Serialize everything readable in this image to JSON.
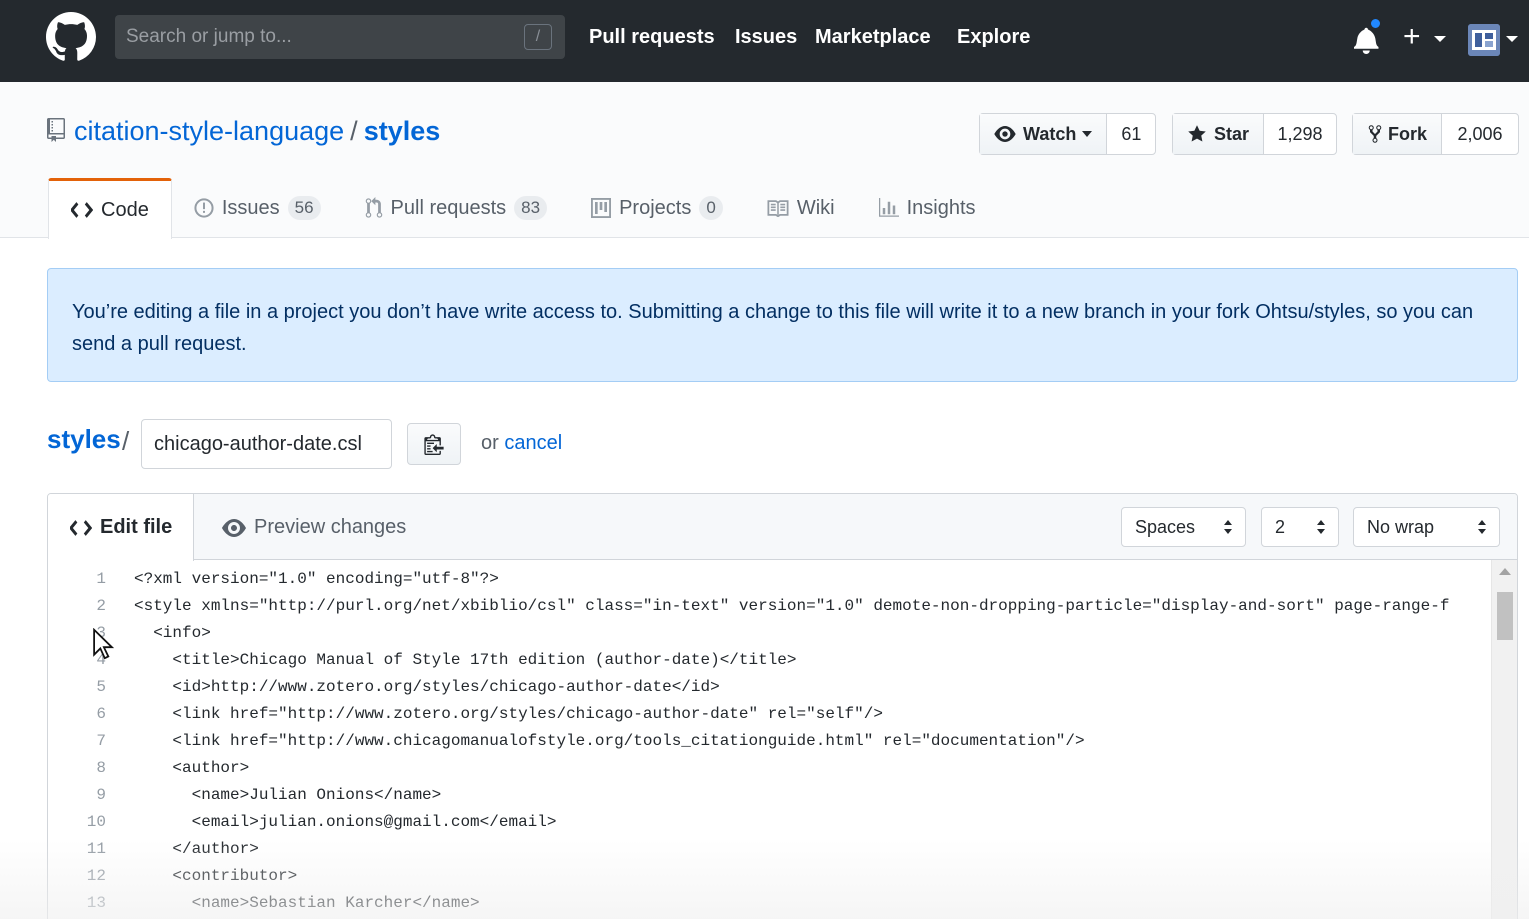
{
  "header": {
    "search_placeholder": "Search or jump to...",
    "search_shortcut": "/",
    "nav": [
      "Pull requests",
      "Issues",
      "Marketplace",
      "Explore"
    ],
    "plus_label": "+"
  },
  "repo": {
    "owner": "citation-style-language",
    "separator": "/",
    "name": "styles",
    "watch_label": "Watch",
    "watch_count": "61",
    "star_label": "Star",
    "star_count": "1,298",
    "fork_label": "Fork",
    "fork_count": "2,006"
  },
  "tabs": {
    "code": "Code",
    "issues": "Issues",
    "issues_count": "56",
    "pulls": "Pull requests",
    "pulls_count": "83",
    "projects": "Projects",
    "projects_count": "0",
    "wiki": "Wiki",
    "insights": "Insights"
  },
  "flash": {
    "message": "You’re editing a file in a project you don’t have write access to. Submitting a change to this file will write it to a new branch in your fork Ohtsu/styles, so you can send a pull request."
  },
  "filename": {
    "root": "styles",
    "separator": "/",
    "value": "chicago-author-date.csl",
    "or_text": "or",
    "cancel_label": "cancel"
  },
  "editor": {
    "edit_tab": "Edit file",
    "preview_tab": "Preview changes",
    "indent_mode": "Spaces",
    "indent_size": "2",
    "wrap_mode": "No wrap",
    "lines": [
      {
        "n": "1",
        "text": "<?xml version=\"1.0\" encoding=\"utf-8\"?>"
      },
      {
        "n": "2",
        "text": "<style xmlns=\"http://purl.org/net/xbiblio/csl\" class=\"in-text\" version=\"1.0\" demote-non-dropping-particle=\"display-and-sort\" page-range-f"
      },
      {
        "n": "3",
        "text": "  <info>"
      },
      {
        "n": "4",
        "text": "    <title>Chicago Manual of Style 17th edition (author-date)</title>"
      },
      {
        "n": "5",
        "text": "    <id>http://www.zotero.org/styles/chicago-author-date</id>"
      },
      {
        "n": "6",
        "text": "    <link href=\"http://www.zotero.org/styles/chicago-author-date\" rel=\"self\"/>"
      },
      {
        "n": "7",
        "text": "    <link href=\"http://www.chicagomanualofstyle.org/tools_citationguide.html\" rel=\"documentation\"/>"
      },
      {
        "n": "8",
        "text": "    <author>"
      },
      {
        "n": "9",
        "text": "      <name>Julian Onions</name>"
      },
      {
        "n": "10",
        "text": "      <email>julian.onions@gmail.com</email>"
      },
      {
        "n": "11",
        "text": "    </author>"
      },
      {
        "n": "12",
        "text": "    <contributor>"
      },
      {
        "n": "13",
        "text": "      <name>Sebastian Karcher</name>"
      }
    ]
  },
  "colors": {
    "header_bg": "#24292e",
    "link": "#0366d6",
    "active_tab_accent": "#e36209",
    "flash_bg": "#dbedff",
    "notification_dot": "#2188ff"
  }
}
